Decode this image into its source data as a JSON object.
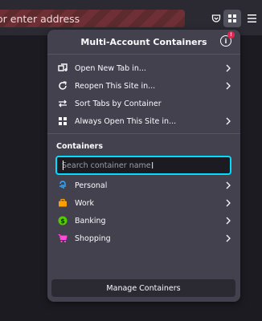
{
  "toolbar": {
    "url_placeholder": "or enter address",
    "pocket_icon": "pocket-icon",
    "containers_icon": "containers-icon",
    "menu_icon": "hamburger-menu-icon"
  },
  "panel": {
    "title": "Multi-Account Containers",
    "info_badge": "!",
    "menu_items": [
      {
        "label": "Open New Tab in...",
        "icon": "new-tab-icon"
      },
      {
        "label": "Reopen This Site in...",
        "icon": "reopen-icon"
      },
      {
        "label": "Sort Tabs by Container",
        "icon": "sort-icon"
      },
      {
        "label": "Always Open This Site in...",
        "icon": "always-open-icon"
      }
    ],
    "containers_label": "Containers",
    "search_placeholder": "Search container name",
    "containers": [
      {
        "label": "Personal",
        "icon": "fingerprint-icon",
        "color": "#37adff"
      },
      {
        "label": "Work",
        "icon": "briefcase-icon",
        "color": "#ff9f00"
      },
      {
        "label": "Banking",
        "icon": "dollar-icon",
        "color": "#51cd00"
      },
      {
        "label": "Shopping",
        "icon": "cart-icon",
        "color": "#ff4bda"
      }
    ],
    "manage_label": "Manage Containers"
  },
  "colors": {
    "panel_bg": "#42414d",
    "accent_focus": "#00ddff",
    "badge": "#e22850"
  }
}
